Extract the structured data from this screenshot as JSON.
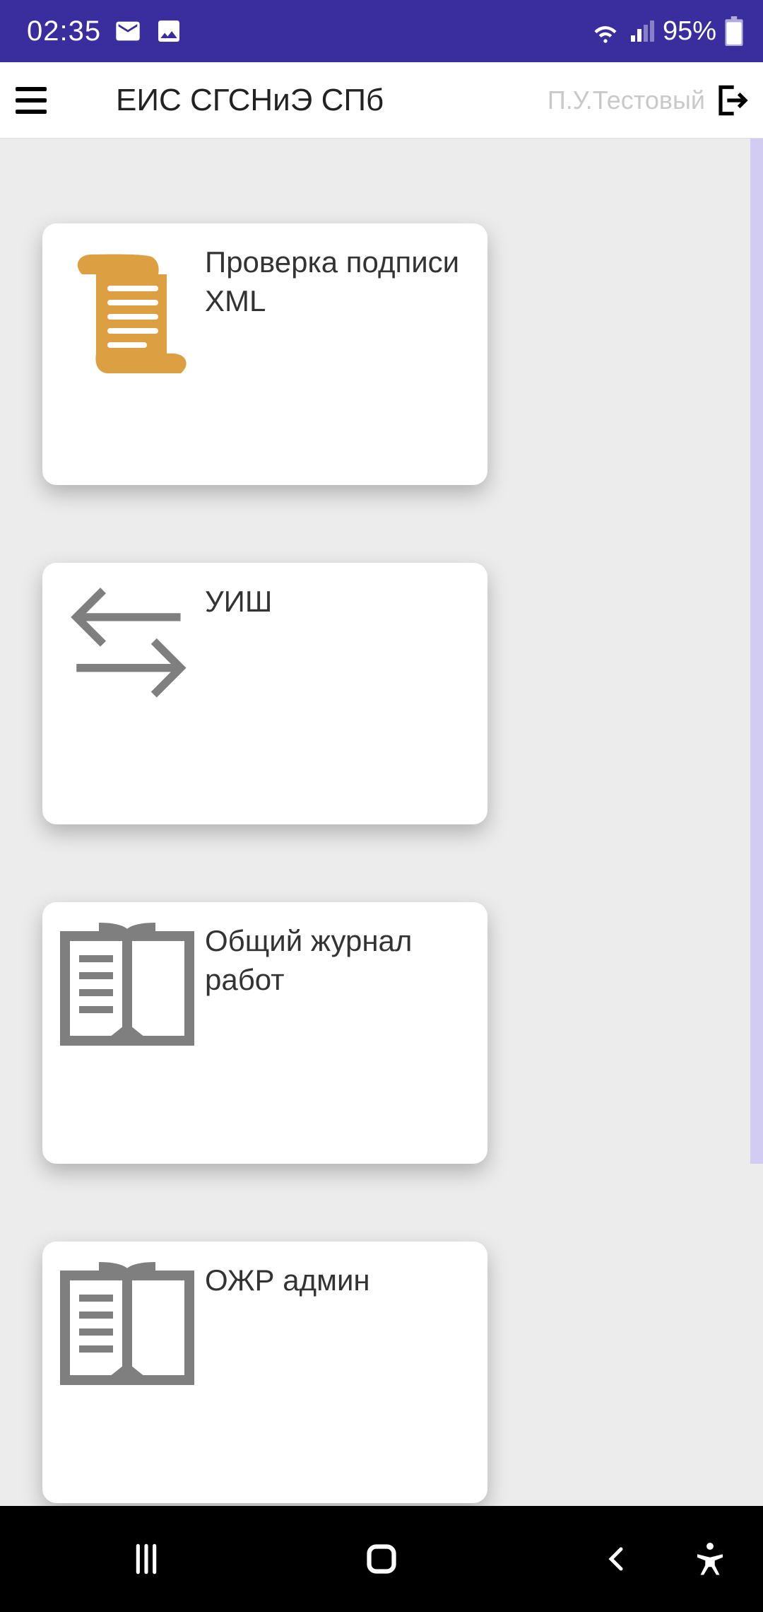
{
  "status": {
    "time": "02:35",
    "battery_pct": "95%"
  },
  "header": {
    "title": "ЕИС СГСНиЭ СПб",
    "user": "П.У.Тестовый"
  },
  "cards": [
    {
      "label": "Проверка подписи XML",
      "icon": "scroll"
    },
    {
      "label": "УИШ",
      "icon": "arrows"
    },
    {
      "label": "Общий журнал работ",
      "icon": "book"
    },
    {
      "label": "ОЖР админ",
      "icon": "book"
    }
  ]
}
